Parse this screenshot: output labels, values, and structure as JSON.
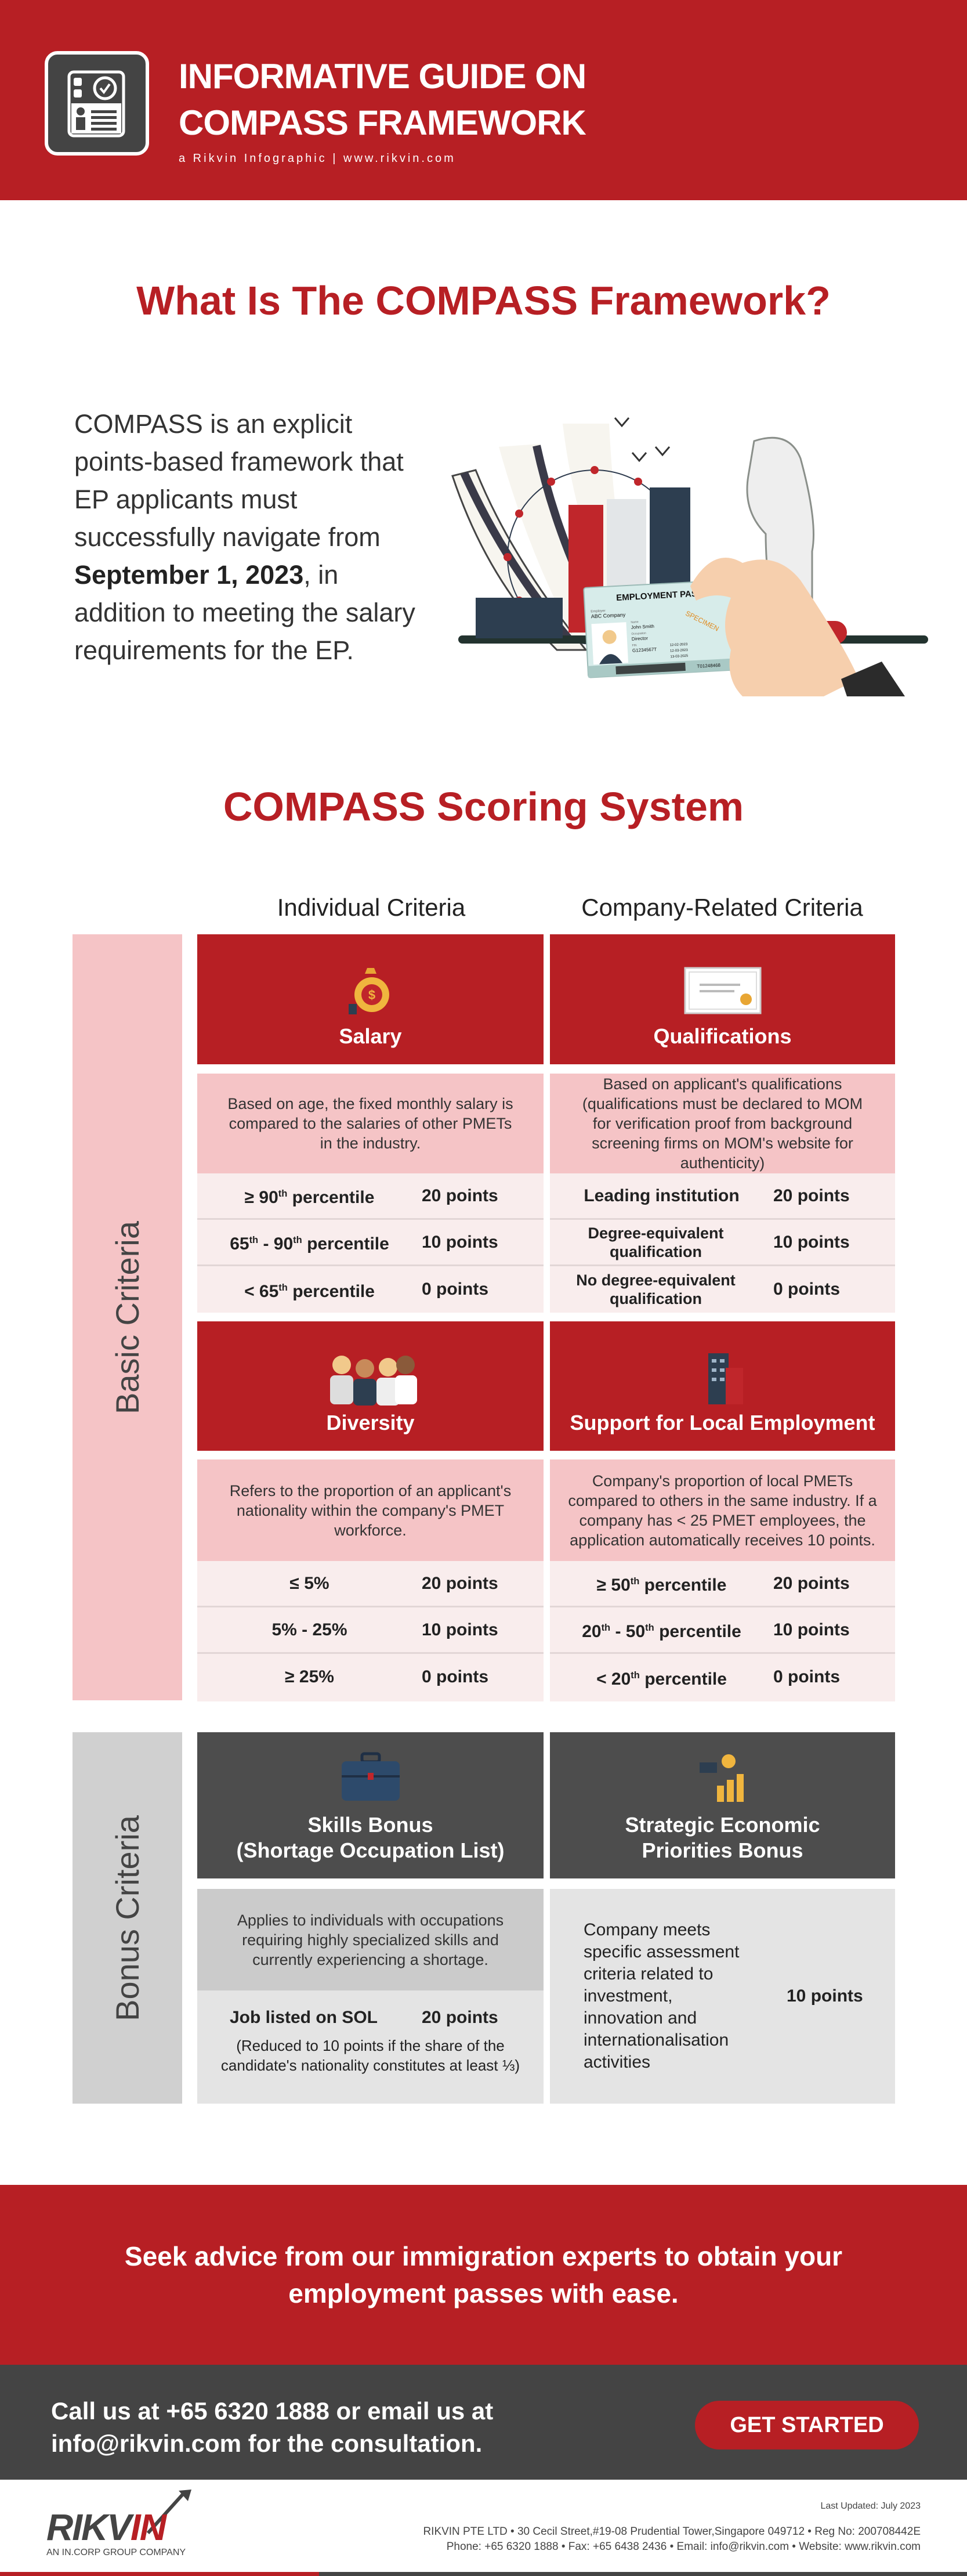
{
  "header": {
    "title_line1": "INFORMATIVE GUIDE ON",
    "title_line2": "COMPASS FRAMEWORK",
    "subtitle": "a Rikvin Infographic  |  www.rikvin.com",
    "icon": "id-card-check-icon"
  },
  "intro": {
    "heading": "What Is The COMPASS Framework?",
    "text_before": "COMPASS is an explicit points-based framework that EP applicants must successfully navigate from ",
    "date": "September 1, 2023",
    "text_after": ", in addition to meeting the salary requirements for the EP.",
    "card": {
      "title": "EMPLOYMENT PASS",
      "employer_label": "Employer",
      "employer": "ABC Company",
      "name_label": "Name",
      "name": "John Smith",
      "occupation_label": "Occupation",
      "occupation": "Director",
      "fin_label": "FIN",
      "fin": "G1234567T",
      "stamp": "SPECIMEN",
      "date1": "12-02-2023",
      "date2": "12-03-2023",
      "date3": "13-03-2025",
      "serial": "T01248468"
    }
  },
  "scoring": {
    "heading": "COMPASS Scoring System",
    "col_individual": "Individual Criteria",
    "col_company": "Company-Related Criteria",
    "basic_label": "Basic Criteria",
    "bonus_label": "Bonus Criteria",
    "salary": {
      "title": "Salary",
      "icon": "money-bag-icon",
      "desc": "Based on age, the fixed monthly salary is compared to the salaries of other PMETs in the industry.",
      "rows": [
        {
          "c": "≥ 90th percentile",
          "p": "20 points"
        },
        {
          "c": "65th - 90th percentile",
          "p": "10 points"
        },
        {
          "c": "< 65th percentile",
          "p": "0  points"
        }
      ]
    },
    "qualifications": {
      "title": "Qualifications",
      "icon": "certificate-icon",
      "desc": "Based on applicant's qualifications (qualifications must be declared to MOM for verification proof from background screening firms on MOM's website for authenticity)",
      "rows": [
        {
          "c": "Leading institution",
          "p": "20 points"
        },
        {
          "c": "Degree-equivalent qualification",
          "p": "10 points"
        },
        {
          "c": "No degree-equivalent qualification",
          "p": "0  points"
        }
      ]
    },
    "diversity": {
      "title": "Diversity",
      "icon": "people-group-icon",
      "desc": "Refers to the proportion of an applicant's nationality within the company's PMET workforce.",
      "rows": [
        {
          "c": "≤ 5%",
          "p": "20 points"
        },
        {
          "c": "5% - 25%",
          "p": "10 points"
        },
        {
          "c": "≥ 25%",
          "p": "0  points"
        }
      ]
    },
    "local": {
      "title": "Support for Local Employment",
      "icon": "office-building-icon",
      "desc": "Company's proportion of local PMETs compared to others in the same industry. If a company has < 25 PMET employees, the application automatically receives 10 points.",
      "rows": [
        {
          "c": "≥ 50th percentile",
          "p": "20 points"
        },
        {
          "c": "20th - 50th percentile",
          "p": "10 points"
        },
        {
          "c": "< 20th percentile",
          "p": "0  points"
        }
      ]
    },
    "skills": {
      "title_line1": "Skills Bonus",
      "title_line2": "(Shortage Occupation List)",
      "icon": "briefcase-icon",
      "desc": "Applies to individuals with occupations requiring highly specialized skills and currently experiencing a shortage.",
      "row_c": "Job listed on SOL",
      "row_p": "20 points",
      "note": "(Reduced to 10 points if the share of the candidate's nationality constitutes at least ⅓)"
    },
    "strategic": {
      "title_line1": "Strategic Economic",
      "title_line2": "Priorities Bonus",
      "icon": "coins-growth-icon",
      "desc": "Company meets specific assessment criteria related to investment, innovation and internationalisation activities",
      "points": "10 points"
    }
  },
  "cta": {
    "text": "Seek advice from our immigration experts to obtain your employment passes with ease."
  },
  "contact": {
    "line1": "Call us at +65 6320 1888 or email us at",
    "line2": "info@rikvin.com for the consultation.",
    "button": "GET STARTED"
  },
  "footer": {
    "logo_a": "RIKV",
    "logo_b": "IN",
    "tagline": "AN IN.CORP GROUP COMPANY",
    "updated": "Last Updated: July 2023",
    "address": "RIKVIN PTE LTD  •  30 Cecil Street,#19-08 Prudential Tower,Singapore 049712  •  Reg No: 200708442E",
    "contacts": "Phone: +65 6320 1888  •  Fax: +65 6438 2436  •  Email: info@rikvin.com  •  Website: www.rikvin.com"
  },
  "colors": {
    "brand_red": "#b71f24",
    "dark": "#444444",
    "pink": "#f5c4c6",
    "light_pink": "#f9eded",
    "gray": "#d0d0d0"
  }
}
